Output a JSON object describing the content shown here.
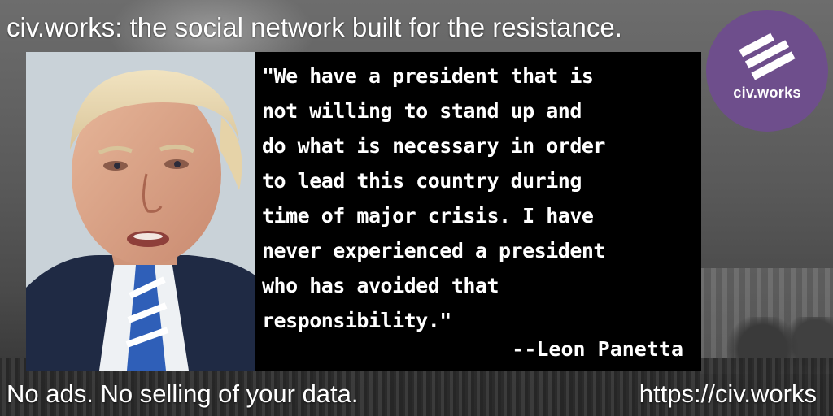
{
  "headline": "civ.works: the social network built for the resistance.",
  "quote": {
    "lines": [
      "\"We have a president that is",
      "not willing to stand up and",
      "do what is necessary in order",
      "to lead this country during",
      "time of major crisis. I have",
      "never experienced a president",
      "who has avoided that",
      "responsibility.\""
    ],
    "attribution": "--Leon Panetta"
  },
  "logo": {
    "text": "civ.works",
    "icon": "civ-works-logo-icon",
    "color": "#6e4e8c"
  },
  "photo": {
    "icon": "portrait-photo"
  },
  "footer": {
    "tagline": "No ads. No selling of your data.",
    "url": "https://civ.works"
  }
}
